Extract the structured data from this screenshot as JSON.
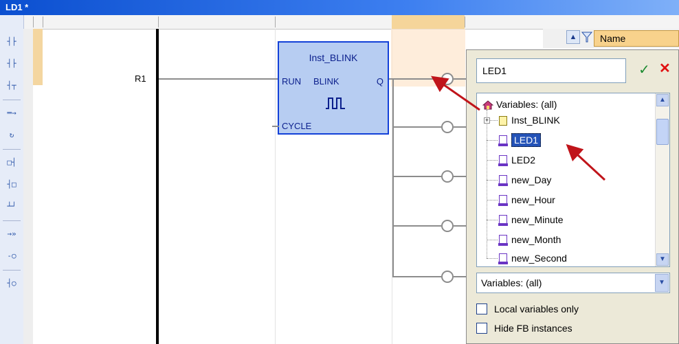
{
  "window": {
    "title": "LD1 *"
  },
  "toolbar": {
    "items": [
      {
        "icon": "contact-icon",
        "glyph": "┤├"
      },
      {
        "icon": "contact-right-icon",
        "glyph": "┤├"
      },
      {
        "icon": "parallel-contact-icon",
        "glyph": "┤┬"
      },
      {
        "icon": "branch-icon",
        "glyph": "═→"
      },
      {
        "icon": "loop-icon",
        "glyph": "↻"
      },
      {
        "icon": "block-left-icon",
        "glyph": "□┤"
      },
      {
        "icon": "block-right-icon",
        "glyph": "┤□"
      },
      {
        "icon": "parallel-block-icon",
        "glyph": "┴┘"
      },
      {
        "icon": "jump-icon",
        "glyph": "→»"
      },
      {
        "icon": "coil-icon",
        "glyph": "-○"
      },
      {
        "icon": "set-coil-icon",
        "glyph": "┤○"
      }
    ]
  },
  "ladder": {
    "contact_label": "R1",
    "function_block": {
      "instance": "Inst_BLINK",
      "input1": "RUN",
      "type": "BLINK",
      "output": "Q",
      "input2": "CYCLE"
    }
  },
  "header": {
    "name_column": "Name"
  },
  "popup": {
    "input_value": "LED1",
    "tree": {
      "root": "Variables: (all)",
      "items": [
        "Inst_BLINK",
        "LED1",
        "LED2",
        "new_Day",
        "new_Hour",
        "new_Minute",
        "new_Month",
        "new_Second"
      ],
      "selected_index": 1
    },
    "filter_value": "Variables: (all)",
    "option1": "Local variables only",
    "option2": "Hide FB instances"
  }
}
